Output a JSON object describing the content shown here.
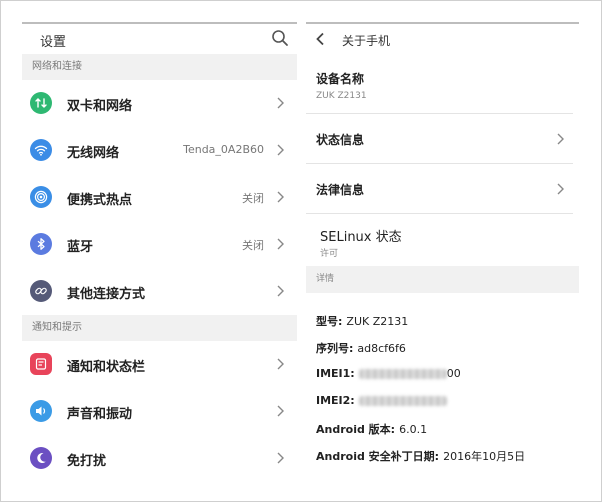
{
  "left": {
    "title": "设置",
    "sections": [
      {
        "header": "网络和连接",
        "items": [
          {
            "label": "双卡和网络",
            "value": "",
            "icon": "sim-network-icon",
            "color": "#2eb872"
          },
          {
            "label": "无线网络",
            "value": "Tenda_0A2B60",
            "icon": "wifi-icon",
            "color": "#3b8ce6"
          },
          {
            "label": "便携式热点",
            "value": "关闭",
            "icon": "hotspot-icon",
            "color": "#3a8ee6"
          },
          {
            "label": "蓝牙",
            "value": "关闭",
            "icon": "bluetooth-icon",
            "color": "#5b7be0"
          },
          {
            "label": "其他连接方式",
            "value": "",
            "icon": "link-icon",
            "color": "#555a78"
          }
        ]
      },
      {
        "header": "通知和提示",
        "items": [
          {
            "label": "通知和状态栏",
            "value": "",
            "icon": "notification-icon",
            "color": "#e8445a"
          },
          {
            "label": "声音和振动",
            "value": "",
            "icon": "volume-icon",
            "color": "#3b9be6"
          },
          {
            "label": "免打扰",
            "value": "",
            "icon": "moon-icon",
            "color": "#6b4fc2"
          }
        ]
      }
    ]
  },
  "right": {
    "title": "关于手机",
    "device_name_label": "设备名称",
    "device_name_value": "ZUK Z2131",
    "status_label": "状态信息",
    "legal_label": "法律信息",
    "selinux_label": "SELinux 状态",
    "selinux_value": "许可",
    "details_header": "详情",
    "details": {
      "model_k": "型号:",
      "model_v": "ZUK Z2131",
      "serial_k": "序列号:",
      "serial_v": "ad8cf6f6",
      "imei1_k": "IMEI1:",
      "imei1_tail": "00",
      "imei2_k": "IMEI2:",
      "android_k": "Android 版本:",
      "android_v": "6.0.1",
      "patch_k": "Android 安全补丁日期:",
      "patch_v": "2016年10月5日"
    }
  }
}
